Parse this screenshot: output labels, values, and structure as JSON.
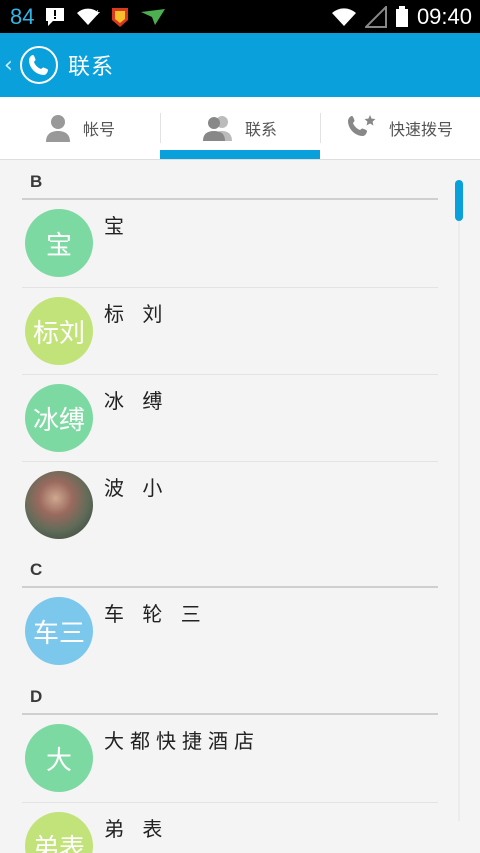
{
  "status_bar": {
    "battery_level": "84",
    "time": "09:40",
    "icons": [
      "notification-icon",
      "wifi-icon",
      "app-badge-icon",
      "signal-arrow-icon",
      "wifi-icon",
      "cell-signal-icon",
      "battery-icon"
    ]
  },
  "app_bar": {
    "back_glyph": "‹",
    "title": "联系",
    "logo_icon": "phone-icon"
  },
  "tabs": [
    {
      "label": "帐号",
      "icon": "person-icon",
      "active": false
    },
    {
      "label": "联系",
      "icon": "contacts-icon",
      "active": true
    },
    {
      "label": "快速拨号",
      "icon": "speed-dial-icon",
      "active": false
    }
  ],
  "colors": {
    "accent": "#0aa0dc",
    "avatar_green": "#7dd9a2",
    "avatar_lime": "#c2e37a",
    "avatar_blue": "#7bc8ec"
  },
  "sections": [
    {
      "letter": "B",
      "contacts": [
        {
          "name": "宝",
          "avatar_text": "宝",
          "avatar_color": "#7dd9a2"
        },
        {
          "name": "标 刘",
          "avatar_text": "标刘",
          "avatar_color": "#c2e37a"
        },
        {
          "name": "冰 缚",
          "avatar_text": "冰缚",
          "avatar_color": "#7dd9a2"
        },
        {
          "name": "波 小",
          "avatar_text": "",
          "avatar_color": "photo"
        }
      ]
    },
    {
      "letter": "C",
      "contacts": [
        {
          "name": "车 轮 三",
          "avatar_text": "车三",
          "avatar_color": "#7bc8ec"
        }
      ]
    },
    {
      "letter": "D",
      "contacts": [
        {
          "name": "大都快捷酒店",
          "avatar_text": "大",
          "avatar_color": "#7dd9a2"
        },
        {
          "name": "弟 表",
          "avatar_text": "弟表",
          "avatar_color": "#c2e37a"
        }
      ]
    }
  ]
}
